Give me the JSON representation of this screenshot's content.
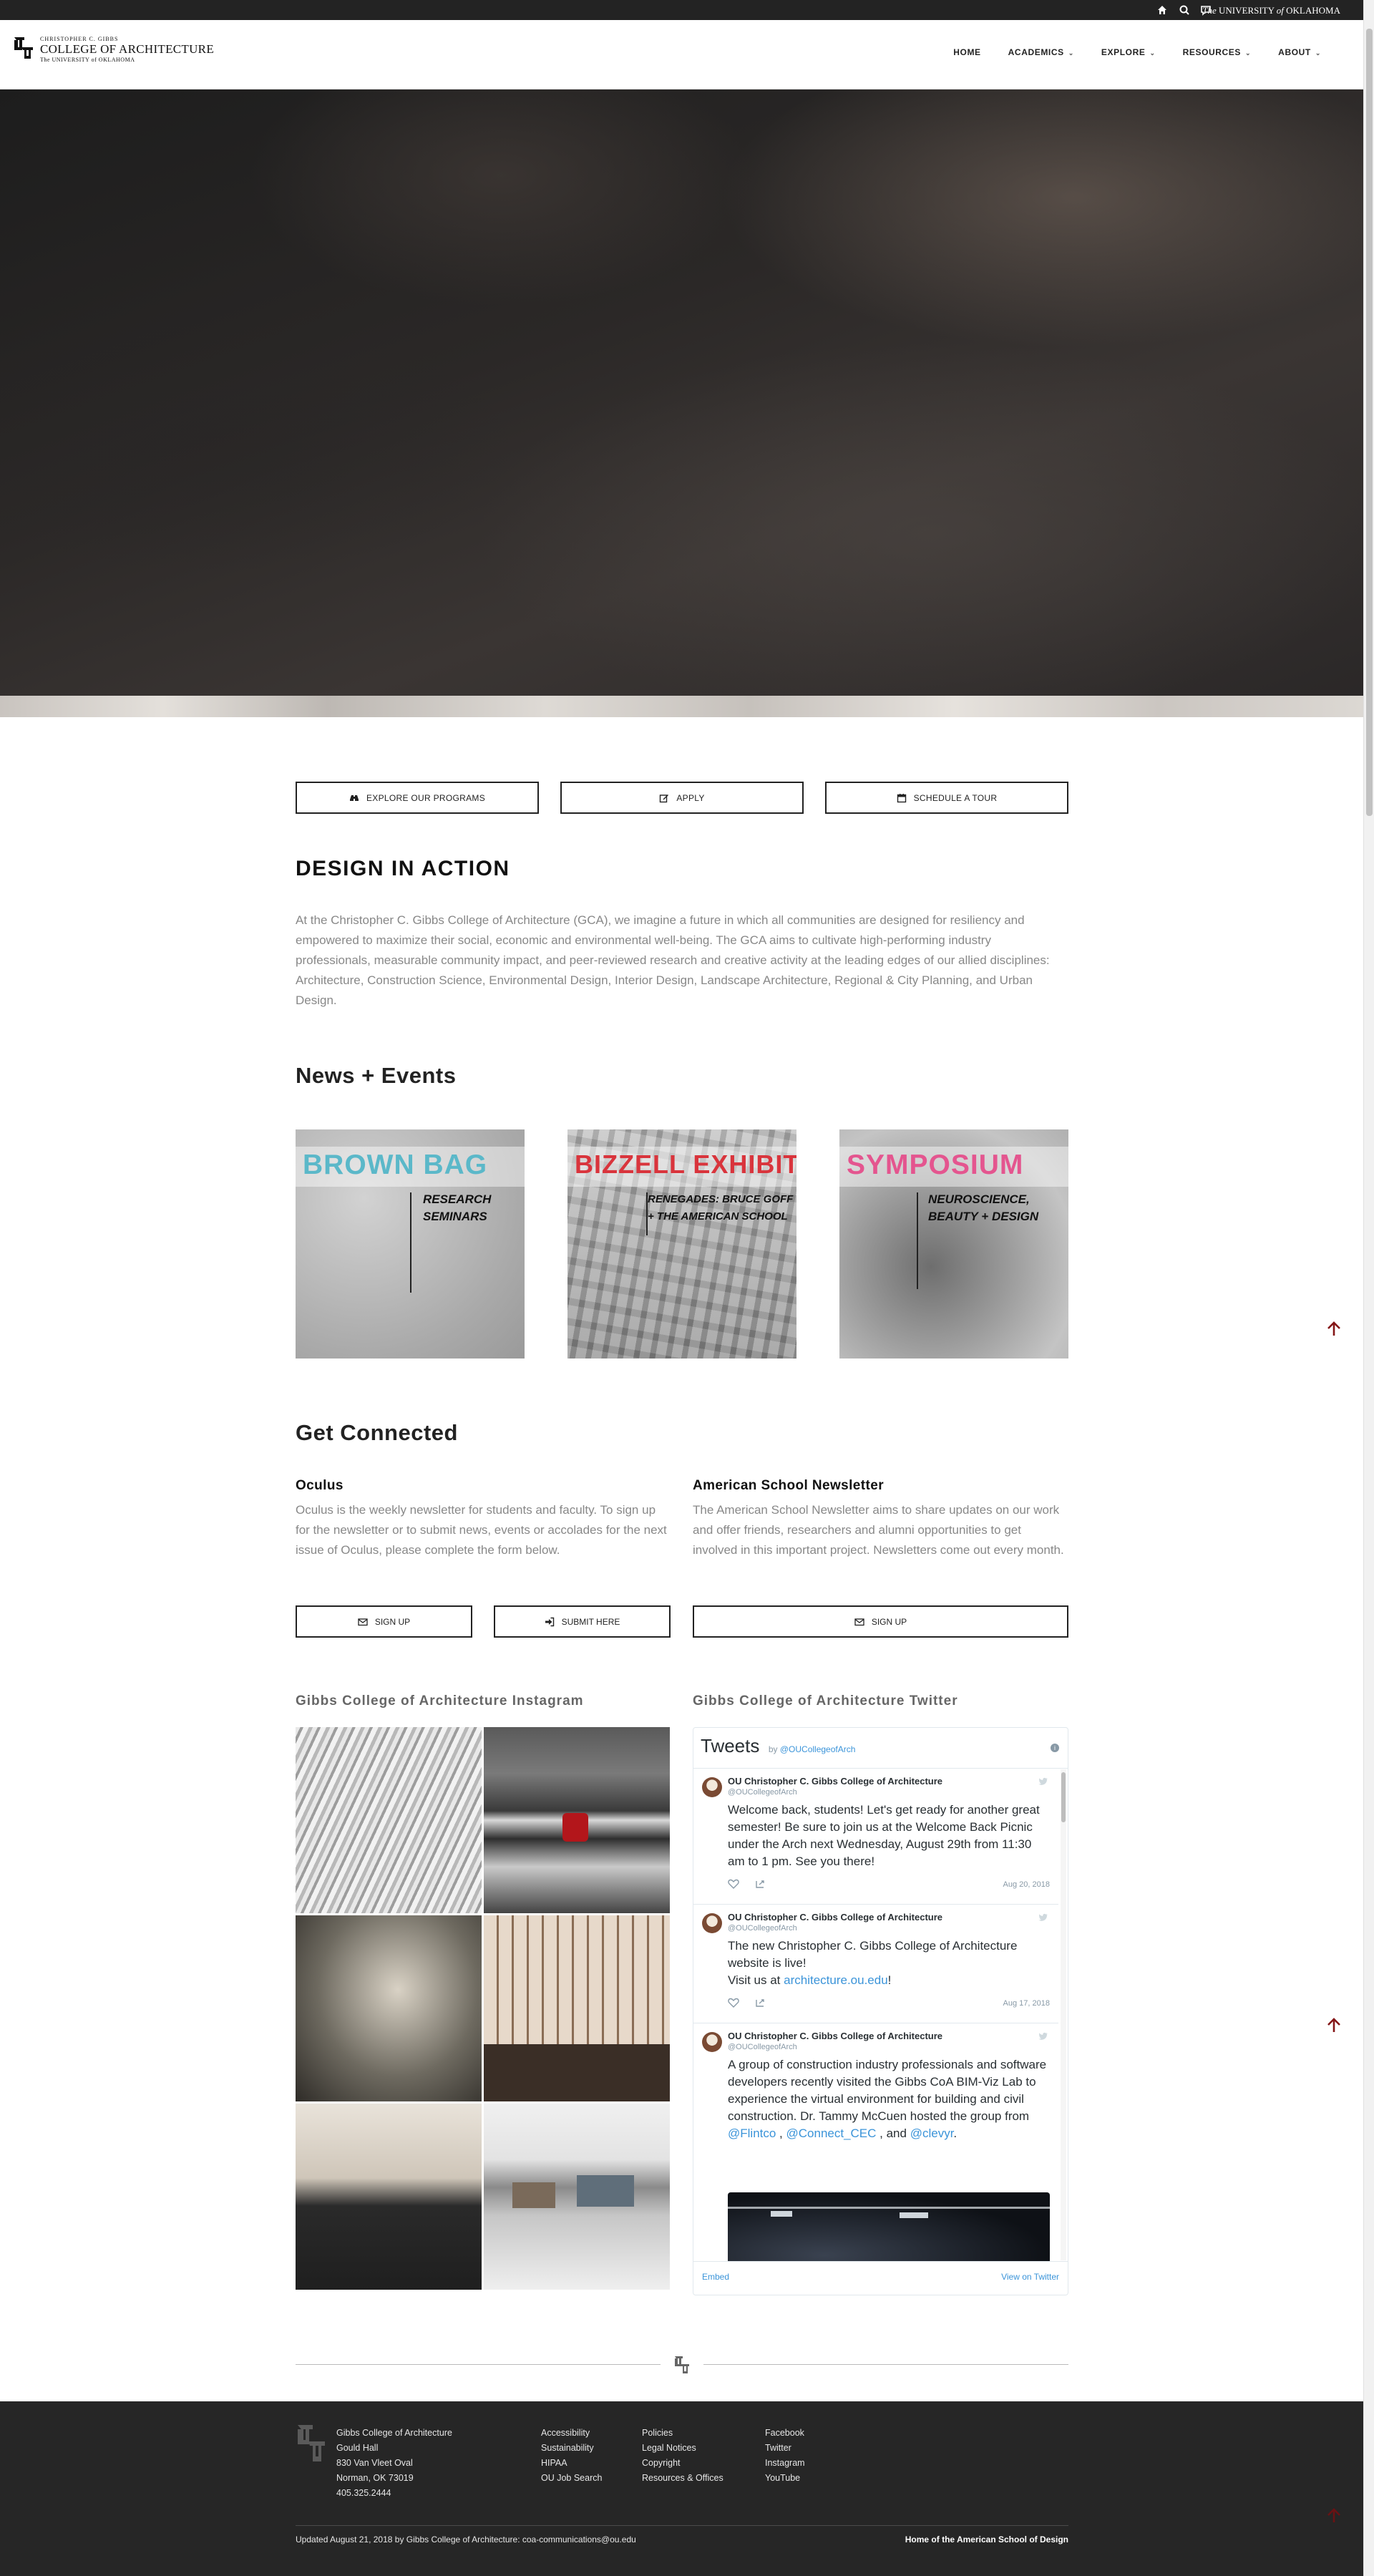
{
  "utility": {
    "home_icon": "home-icon",
    "search_icon": "search-icon",
    "chat_icon": "chat-icon",
    "ou_prefix": "The",
    "ou_name": "UNIVERSITY",
    "ou_of": "of",
    "ou_state": "OKLAHOMA"
  },
  "logo": {
    "small": "CHRISTOPHER C. GIBBS",
    "main": "COLLEGE OF ARCHITECTURE",
    "sub": "The UNIVERSITY of OKLAHOMA"
  },
  "nav": [
    {
      "label": "HOME",
      "has_menu": false
    },
    {
      "label": "ACADEMICS",
      "has_menu": true
    },
    {
      "label": "EXPLORE",
      "has_menu": true
    },
    {
      "label": "RESOURCES",
      "has_menu": true
    },
    {
      "label": "ABOUT",
      "has_menu": true
    }
  ],
  "cta": {
    "explore": "EXPLORE OUR PROGRAMS",
    "apply": "APPLY",
    "tour": "SCHEDULE A TOUR"
  },
  "design": {
    "title": "DESIGN IN ACTION",
    "text": "At the Christopher C. Gibbs College of Architecture (GCA), we imagine a future in which all communities are designed for resiliency and empowered to maximize their social, economic and environmental well-being. The GCA aims to cultivate high-performing industry professionals, measurable community impact, and peer-reviewed research and creative activity at the leading edges of our allied disciplines: Architecture, Construction Science, Environmental Design, Interior Design, Landscape Architecture, Regional & City Planning, and Urban Design."
  },
  "news": {
    "title": "News + Events",
    "cards": [
      {
        "title": "BROWN BAG",
        "line1": "RESEARCH",
        "line2": "SEMINARS",
        "color": "#5bb8c9"
      },
      {
        "title": "BIZZELL EXHIBIT",
        "line1": "RENEGADES: BRUCE GOFF",
        "line2": "+ THE AMERICAN SCHOOL",
        "color": "#d9343c"
      },
      {
        "title": "SYMPOSIUM",
        "line1": "NEUROSCIENCE,",
        "line2": "BEAUTY + DESIGN",
        "color": "#e4558f"
      }
    ]
  },
  "connected": {
    "title": "Get Connected",
    "oculus": {
      "title": "Oculus",
      "text": "Oculus is the weekly newsletter for students and faculty. To sign up for the newsletter or to submit news, events or accolades for the next issue of Oculus, please complete the form below.",
      "signup": "SIGN UP",
      "submit": "SUBMIT HERE"
    },
    "american": {
      "title": "American School Newsletter",
      "text": "The American School Newsletter aims to share updates on our work and offer friends, researchers and alumni opportunities to get involved in this important project. Newsletters come out every month.",
      "signup": "SIGN UP"
    }
  },
  "instagram": {
    "title": "Gibbs College of Architecture Instagram"
  },
  "twitter": {
    "title": "Gibbs College of Architecture Twitter",
    "widget_title": "Tweets",
    "by": "by",
    "handle_link": "@OUCollegeofArch",
    "tweets": [
      {
        "name": "OU Christopher C. Gibbs College of Architecture",
        "handle": "@OUCollegeofArch",
        "text": "Welcome back, students! Let's get ready for another great semester! Be sure to join us at the Welcome Back Picnic under the Arch next Wednesday, August 29th from 11:30 am to 1 pm. See you there!",
        "date": "Aug 20, 2018"
      },
      {
        "name": "OU Christopher C. Gibbs College of Architecture",
        "handle": "@OUCollegeofArch",
        "text1": "The new Christopher C. Gibbs College of Architecture website is live!",
        "text2_pre": "Visit us at ",
        "text2_link": "architecture.ou.edu",
        "text2_post": "!",
        "date": "Aug 17, 2018"
      },
      {
        "name": "OU Christopher C. Gibbs College of Architecture",
        "handle": "@OUCollegeofArch",
        "text_pre": "A group of construction industry professionals and software developers recently visited the Gibbs CoA BIM-Viz Lab to experience the virtual environment for building and civil construction. Dr. Tammy McCuen hosted the group from ",
        "link1": "@Flintco",
        "sep1": " , ",
        "link2": "@Connect_CEC",
        "sep2": " , and ",
        "link3": "@clevyr",
        "text_post": "."
      }
    ],
    "embed": "Embed",
    "view": "View on Twitter"
  },
  "footer": {
    "address": [
      "Gibbs College of Architecture",
      "Gould Hall",
      "830 Van Vleet Oval",
      "Norman, OK 73019",
      "405.325.2444"
    ],
    "col1": [
      "Accessibility",
      "Sustainability",
      "HIPAA",
      "OU Job Search"
    ],
    "col2": [
      "Policies",
      "Legal Notices",
      "Copyright",
      "Resources & Offices"
    ],
    "col3": [
      "Facebook",
      "Twitter",
      "Instagram",
      "YouTube"
    ],
    "updated": "Updated August 21, 2018 by Gibbs College of Architecture: coa-communications@ou.edu",
    "home_link": "Home of the American School of Design"
  },
  "colors": {
    "accent": "#841617",
    "link": "#3b94d9",
    "footer_bg": "#262626"
  }
}
